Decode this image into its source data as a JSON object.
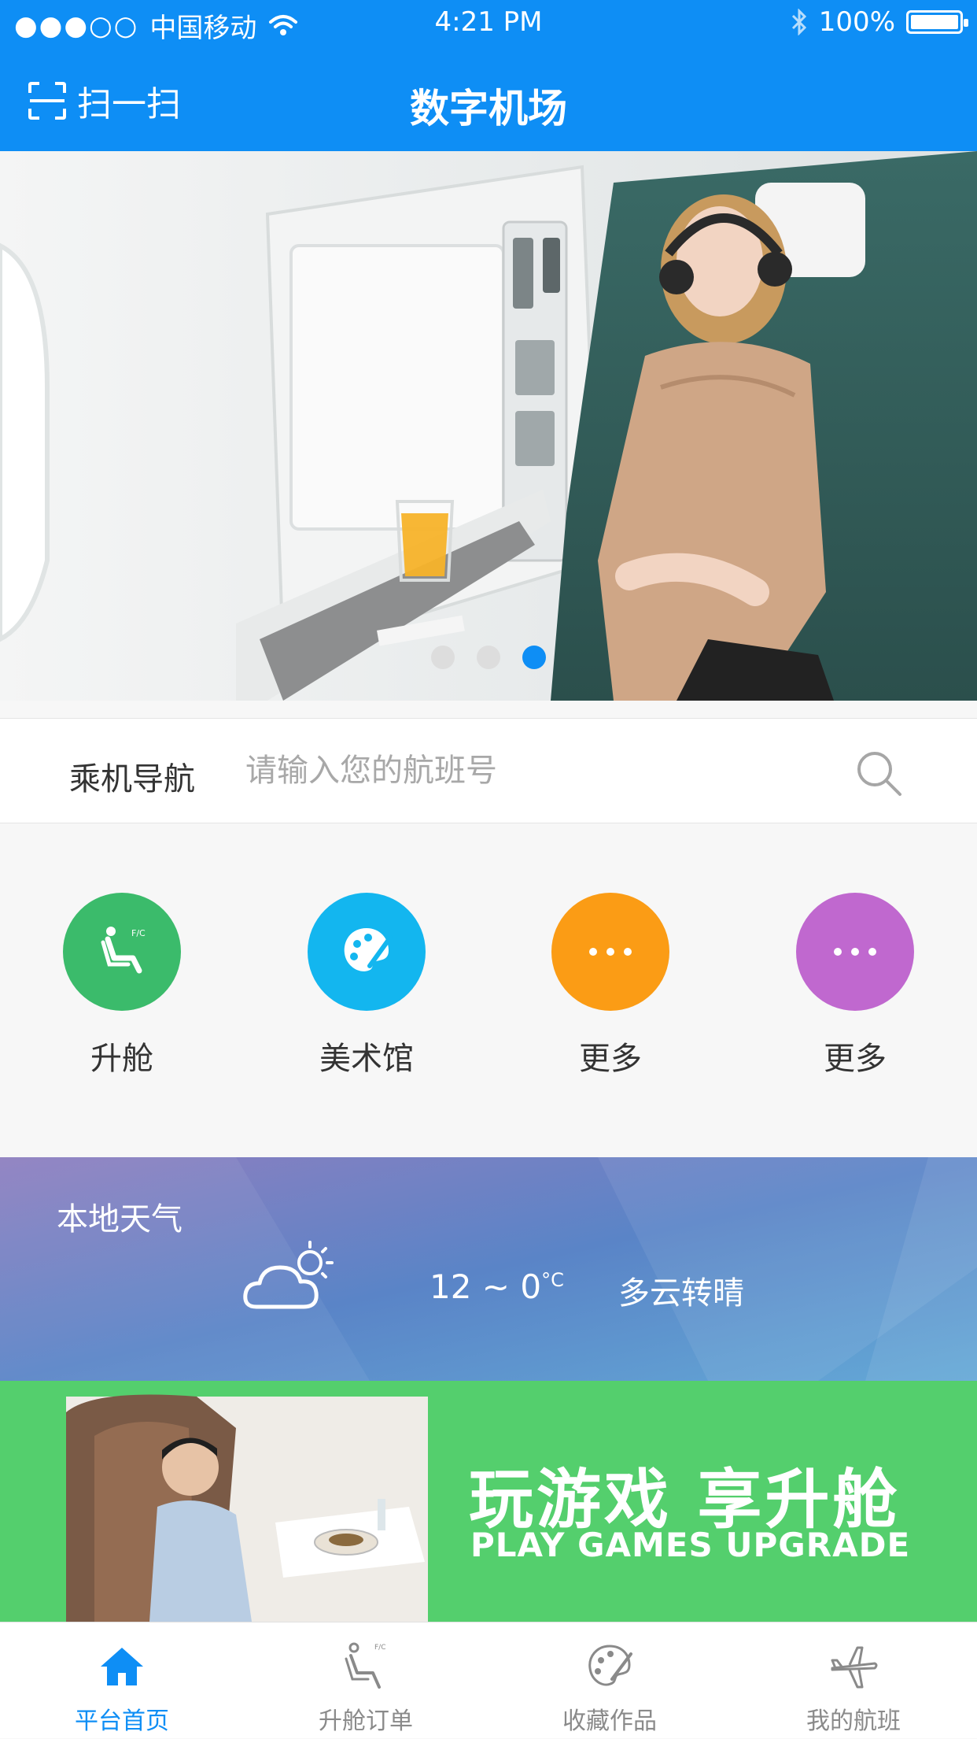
{
  "status_bar": {
    "signal": "●●●○○",
    "carrier": "中国移动",
    "time": "4:21 PM",
    "battery_text": "100%"
  },
  "navbar": {
    "scan_label": "扫一扫",
    "title": "数字机场"
  },
  "hero": {
    "slide_count": 3,
    "active_index": 2
  },
  "search": {
    "label": "乘机导航",
    "placeholder": "请输入您的航班号",
    "value": ""
  },
  "actions": [
    {
      "label": "升舱",
      "color": "#3bbb6b",
      "icon": "seat-icon"
    },
    {
      "label": "美术馆",
      "color": "#13b6ef",
      "icon": "palette-icon"
    },
    {
      "label": "更多",
      "color": "#fb9c15",
      "icon": "more-icon"
    },
    {
      "label": "更多",
      "color": "#c068cf",
      "icon": "more-icon"
    }
  ],
  "weather": {
    "title": "本地天气",
    "temp": "12 ~ 0",
    "unit": "°C",
    "description": "多云转晴",
    "icon": "partly-cloudy-icon"
  },
  "promo": {
    "headline": "玩游戏 享升舱",
    "subline": "PLAY GAMES UPGRADE"
  },
  "tabbar": {
    "tabs": [
      {
        "label": "平台首页",
        "icon": "home-icon",
        "active": true
      },
      {
        "label": "升舱订单",
        "icon": "seat-icon",
        "active": false
      },
      {
        "label": "收藏作品",
        "icon": "palette-icon",
        "active": false
      },
      {
        "label": "我的航班",
        "icon": "plane-icon",
        "active": false
      }
    ]
  },
  "colors": {
    "primary": "#0e8ef5",
    "promo_green": "#54cf6d"
  }
}
